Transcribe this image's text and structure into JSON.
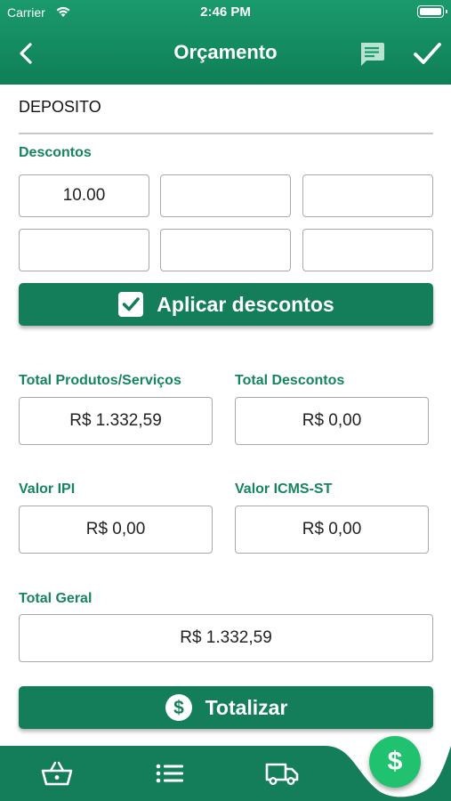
{
  "status_bar": {
    "carrier": "Carrier",
    "time": "2:46 PM"
  },
  "nav": {
    "title": "Orçamento"
  },
  "deposit_label": "DEPOSITO",
  "discounts": {
    "label": "Descontos",
    "values": [
      "10.00",
      "",
      "",
      "",
      "",
      ""
    ],
    "apply_button": "Aplicar descontos"
  },
  "totals": {
    "products_label": "Total Produtos/Serviços",
    "products_value": "R$ 1.332,59",
    "discounts_label": "Total Descontos",
    "discounts_value": "R$ 0,00",
    "ipi_label": "Valor IPI",
    "ipi_value": "R$ 0,00",
    "icms_label": "Valor ICMS-ST",
    "icms_value": "R$ 0,00",
    "general_label": "Total Geral",
    "general_value": "R$ 1.332,59"
  },
  "totalize_button": "Totalizar",
  "fab_symbol": "$",
  "tabbar": {
    "items": [
      "basket-icon",
      "list-icon",
      "truck-icon"
    ]
  },
  "colors": {
    "primary": "#137e59",
    "header": "#1a9a6c",
    "label": "#16855e",
    "fab": "#21c26f"
  }
}
